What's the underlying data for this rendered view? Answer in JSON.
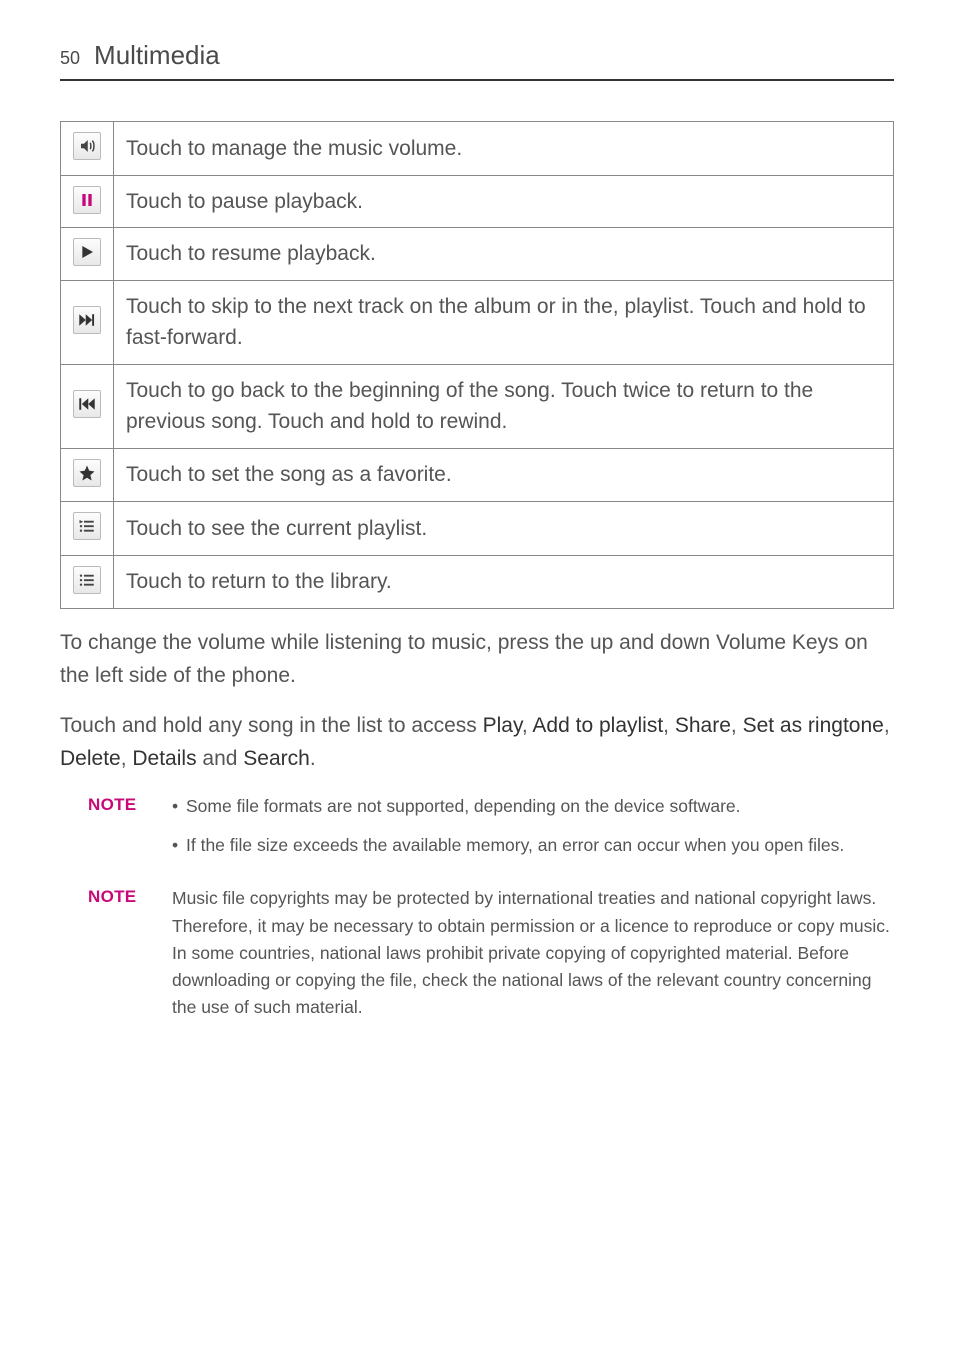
{
  "header": {
    "page_number": "50",
    "title": "Multimedia"
  },
  "rows": [
    {
      "icon": "volume-icon",
      "desc": "Touch to manage the music volume."
    },
    {
      "icon": "pause-icon",
      "desc": "Touch to pause playback."
    },
    {
      "icon": "play-icon",
      "desc": "Touch to resume playback."
    },
    {
      "icon": "next-icon",
      "desc": "Touch to skip to the next track on the album or in the, playlist. Touch and hold to fast-forward."
    },
    {
      "icon": "prev-icon",
      "desc": "Touch to go back to the beginning of the song. Touch twice to return to the previous song. Touch and hold to rewind."
    },
    {
      "icon": "favorite-icon",
      "desc": "Touch to set the song as a favorite."
    },
    {
      "icon": "playlist-icon",
      "desc": "Touch to see the current playlist."
    },
    {
      "icon": "library-icon",
      "desc": "Touch to return to the library."
    }
  ],
  "paras": {
    "volume_tip": "To change the volume while listening to music, press the up and down Volume Keys on the left side of the phone.",
    "context_prefix": "Touch and hold any song in the list to access ",
    "context_items": {
      "play": "Play",
      "add": "Add to playlist",
      "share": "Share",
      "ringtone": "Set as ringtone",
      "delete": "Delete",
      "details": "Details",
      "search": "Search"
    },
    "context_and": " and ",
    "comma": ", ",
    "period": "."
  },
  "notes": {
    "label": "NOTE",
    "bullet": "•",
    "n1a": " Some file formats are not supported, depending on the device software.",
    "n1b": " If the file size exceeds the available memory, an error can occur when you open files.",
    "n2": "Music file copyrights may be protected by international treaties and national copyright laws. Therefore, it may be necessary to obtain permission or a licence to reproduce or copy music. In some countries, national laws prohibit private copying of copyrighted material. Before downloading or copying the file, check the national laws of the relevant country concerning the use of such material."
  }
}
